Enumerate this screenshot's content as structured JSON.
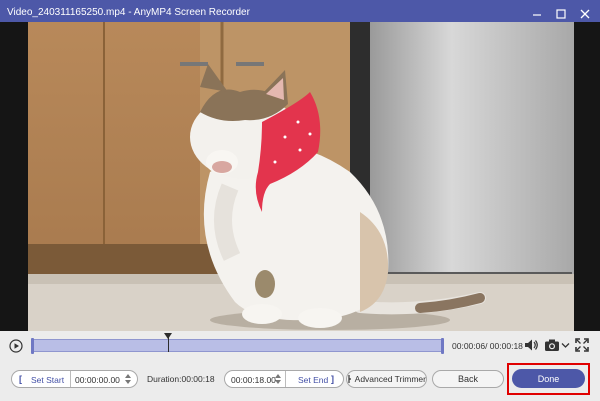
{
  "window": {
    "title": "Video_240311165250.mp4  -  AnyMP4 Screen Recorder"
  },
  "player": {
    "time_display": "00:00:06/ 00:00:18",
    "playhead_fraction": 0.33
  },
  "trim": {
    "set_start_label": "Set Start",
    "start_time": "00:00:00.00",
    "duration_text": "Duration:00:00:18",
    "end_time": "00:00:18.00",
    "set_end_label": "Set End",
    "advanced_trimmer_label": "Advanced Trimmer"
  },
  "actions": {
    "back_label": "Back",
    "done_label": "Done"
  },
  "colors": {
    "titlebar": "#4d58a8",
    "accent": "#4350a6",
    "track_fill": "#b9bee6",
    "highlight_frame": "#e00000"
  },
  "icons": [
    "minimize-icon",
    "maximize-icon",
    "close-icon",
    "play-icon",
    "volume-icon",
    "camera-icon",
    "chevron-down-icon",
    "fullscreen-icon",
    "trim-icon"
  ]
}
